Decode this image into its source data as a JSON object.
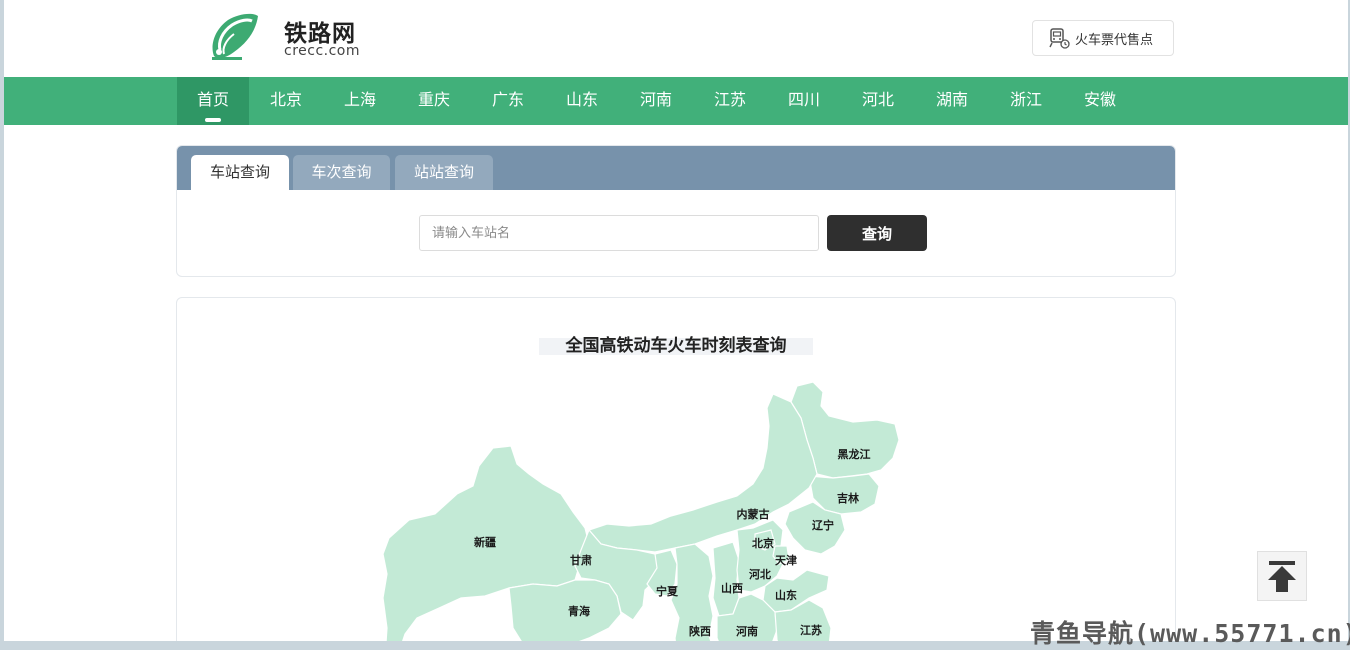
{
  "header": {
    "logo_title": "铁路网",
    "logo_sub": "crecc.com",
    "ticket_button": "火车票代售点"
  },
  "nav": {
    "items": [
      "首页",
      "北京",
      "上海",
      "重庆",
      "广东",
      "山东",
      "河南",
      "江苏",
      "四川",
      "河北",
      "湖南",
      "浙江",
      "安徽"
    ],
    "active": "首页"
  },
  "search": {
    "tabs": [
      "车站查询",
      "车次查询",
      "站站查询"
    ],
    "active_tab": "车站查询",
    "placeholder": "请输入车站名",
    "value": "",
    "button": "查询"
  },
  "map": {
    "title": "全国高铁动车火车时刻表查询",
    "provinces": [
      "黑龙江",
      "吉林",
      "内蒙古",
      "辽宁",
      "北京",
      "天津",
      "新疆",
      "甘肃",
      "河北",
      "宁夏",
      "山西",
      "山东",
      "青海",
      "陕西",
      "河南",
      "江苏"
    ]
  },
  "watermark": "青鱼导航(www.55771.cn)",
  "colors": {
    "nav_green": "#41b07a",
    "nav_active": "#2f9765",
    "tab_bar": "#7792ab",
    "map_fill": "#c3ead6",
    "button_dark": "#2f2f2f"
  },
  "icons": {
    "back_to_top": "arrow-up-bar-icon",
    "ticket": "ticket-office-icon",
    "logo": "train-logo-icon"
  }
}
